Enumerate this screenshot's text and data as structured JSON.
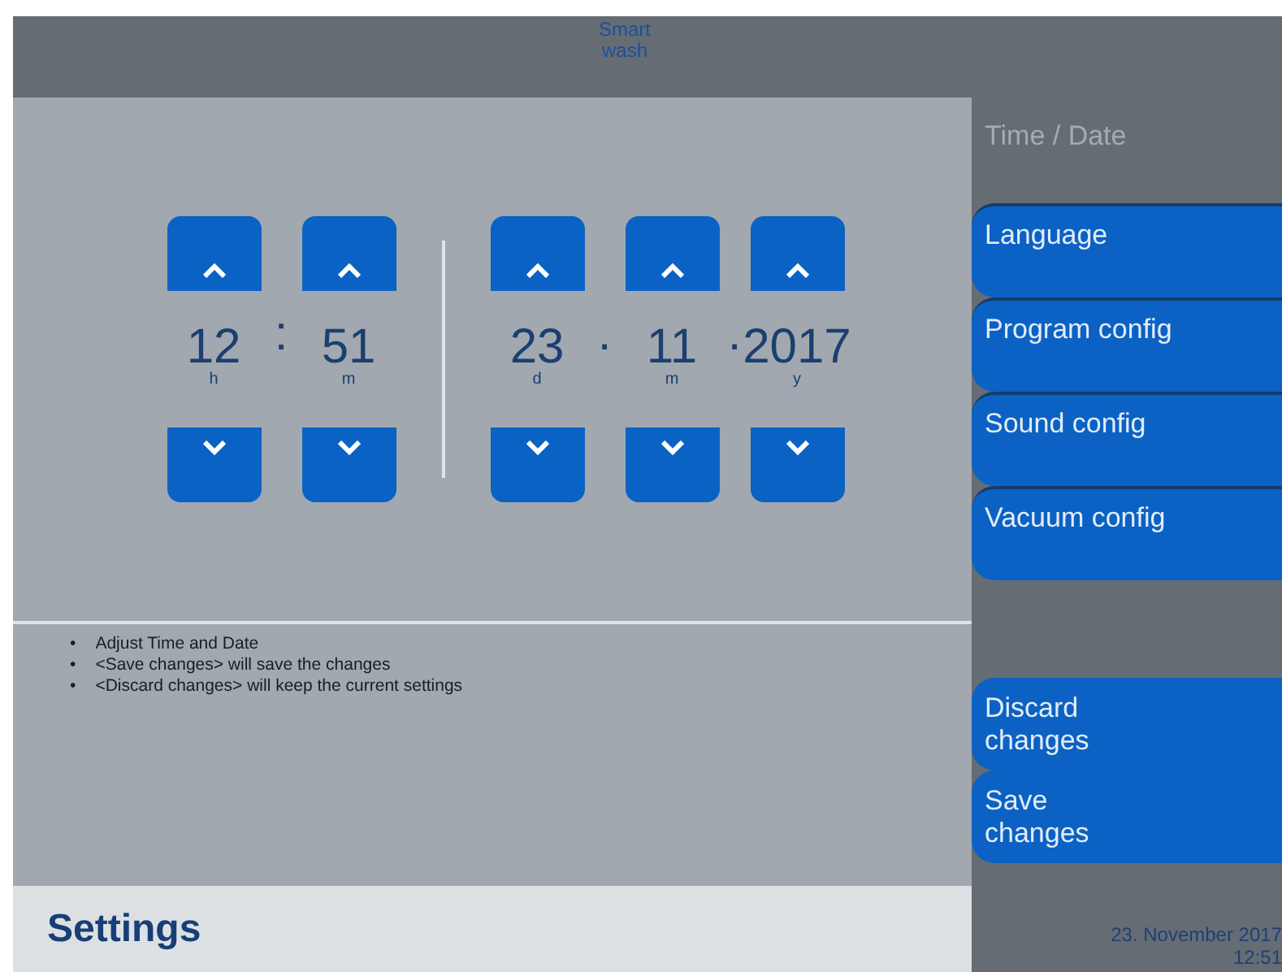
{
  "header": {
    "title": "Smart wash"
  },
  "time_fields": [
    {
      "value": "12",
      "unit": "h"
    },
    {
      "value": "51",
      "unit": "m",
      "separator": ":"
    }
  ],
  "date_fields": [
    {
      "value": "23",
      "unit": "d"
    },
    {
      "value": "11",
      "unit": "m",
      "separator": "."
    },
    {
      "value": "2017",
      "unit": "y",
      "separator": "."
    }
  ],
  "help": [
    {
      "bullet": "•",
      "text": "Adjust Time and Date"
    },
    {
      "bullet": "•",
      "text": "<Save changes> will save the changes"
    },
    {
      "bullet": "•",
      "text": "<Discard changes> will keep the current settings"
    }
  ],
  "menu": [
    {
      "label": "Time / Date",
      "selected": true
    },
    {
      "label": "Language",
      "selected": false
    },
    {
      "label": "Program config",
      "selected": false
    },
    {
      "label": "Sound config",
      "selected": false
    },
    {
      "label": "Vacuum config",
      "selected": false
    }
  ],
  "actions": [
    {
      "label": "Discard changes"
    },
    {
      "label": "Save changes"
    }
  ],
  "footer": {
    "title": "Settings",
    "date": "23. November 2017",
    "time": "12:51"
  }
}
